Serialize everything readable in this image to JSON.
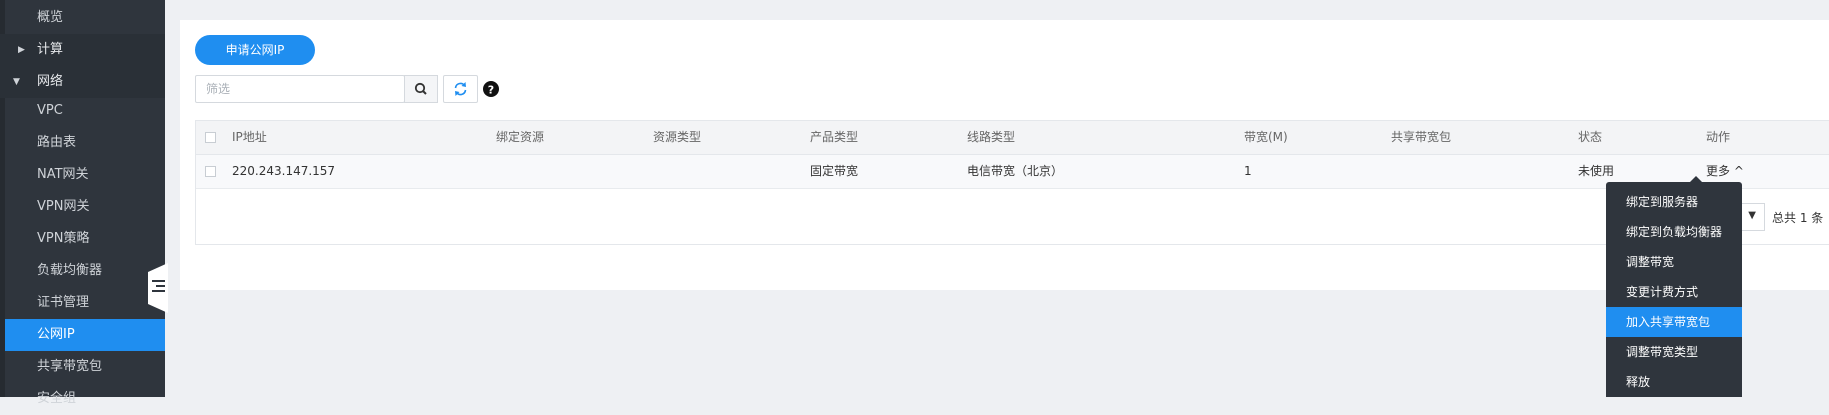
{
  "sidebar": {
    "items": [
      {
        "label": "概览"
      },
      {
        "label": "计算"
      },
      {
        "label": "网络"
      },
      {
        "label": "VPC"
      },
      {
        "label": "路由表"
      },
      {
        "label": "NAT网关"
      },
      {
        "label": "VPN网关"
      },
      {
        "label": "VPN策略"
      },
      {
        "label": "负载均衡器"
      },
      {
        "label": "证书管理"
      },
      {
        "label": "公网IP"
      },
      {
        "label": "共享带宽包"
      },
      {
        "label": "安全组"
      }
    ],
    "active": "公网IP"
  },
  "toolbar": {
    "apply_label": "申请公网IP",
    "filter_placeholder": "筛选",
    "search_icon": "search-icon",
    "refresh_icon": "refresh-icon",
    "help_icon": "help-icon"
  },
  "table": {
    "headers": [
      "IP地址",
      "绑定资源",
      "资源类型",
      "产品类型",
      "线路类型",
      "带宽(M)",
      "共享带宽包",
      "状态",
      "动作"
    ],
    "rows": [
      {
        "ip": "220.243.147.157",
        "resource": "",
        "resource_type": "",
        "product_type": "固定带宽",
        "line_type": "电信带宽（北京）",
        "bandwidth": "1",
        "shared_bandwidth": "",
        "status": "未使用",
        "action": "更多 ^"
      }
    ]
  },
  "pagination": {
    "total": "总共 1 条"
  },
  "more_menu": {
    "items": [
      "绑定到服务器",
      "绑定到负载均衡器",
      "调整带宽",
      "变更计费方式",
      "加入共享带宽包",
      "调整带宽类型",
      "释放"
    ],
    "highlighted": "加入共享带宽包"
  },
  "colors": {
    "accent": "#1f8ef0",
    "sidebar_bg": "#2f353d",
    "menu_bg": "#2f353d"
  }
}
